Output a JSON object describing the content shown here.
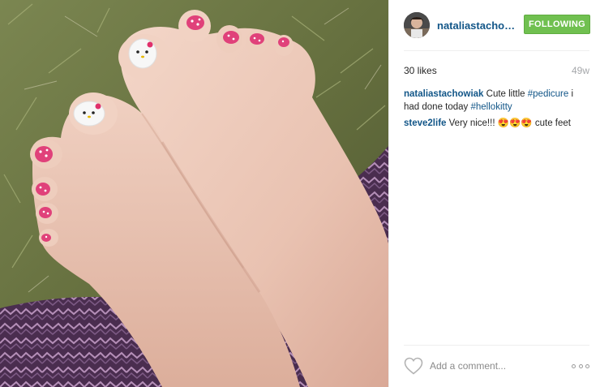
{
  "photo": {
    "alt": ""
  },
  "header": {
    "username": "nataliastachowi...",
    "follow_label": "FOLLOWING"
  },
  "meta": {
    "likes": "30 likes",
    "age": "49w"
  },
  "comments": [
    {
      "user": "nataliastachowiak",
      "text_1": " Cute little ",
      "tag_1": "#pedicure",
      "text_2": " i had done today ",
      "tag_2": "#hellokitty"
    },
    {
      "user": "steve2life",
      "text_1": " Very nice!!! 😍😍😍 cute feet"
    }
  ],
  "footer": {
    "comment_placeholder": "Add a comment..."
  },
  "colors": {
    "link": "#125688",
    "follow_bg": "#70c050",
    "muted": "#a5a7aa"
  },
  "icons": {
    "like": "heart-outline-icon",
    "more": "more-options-icon"
  }
}
